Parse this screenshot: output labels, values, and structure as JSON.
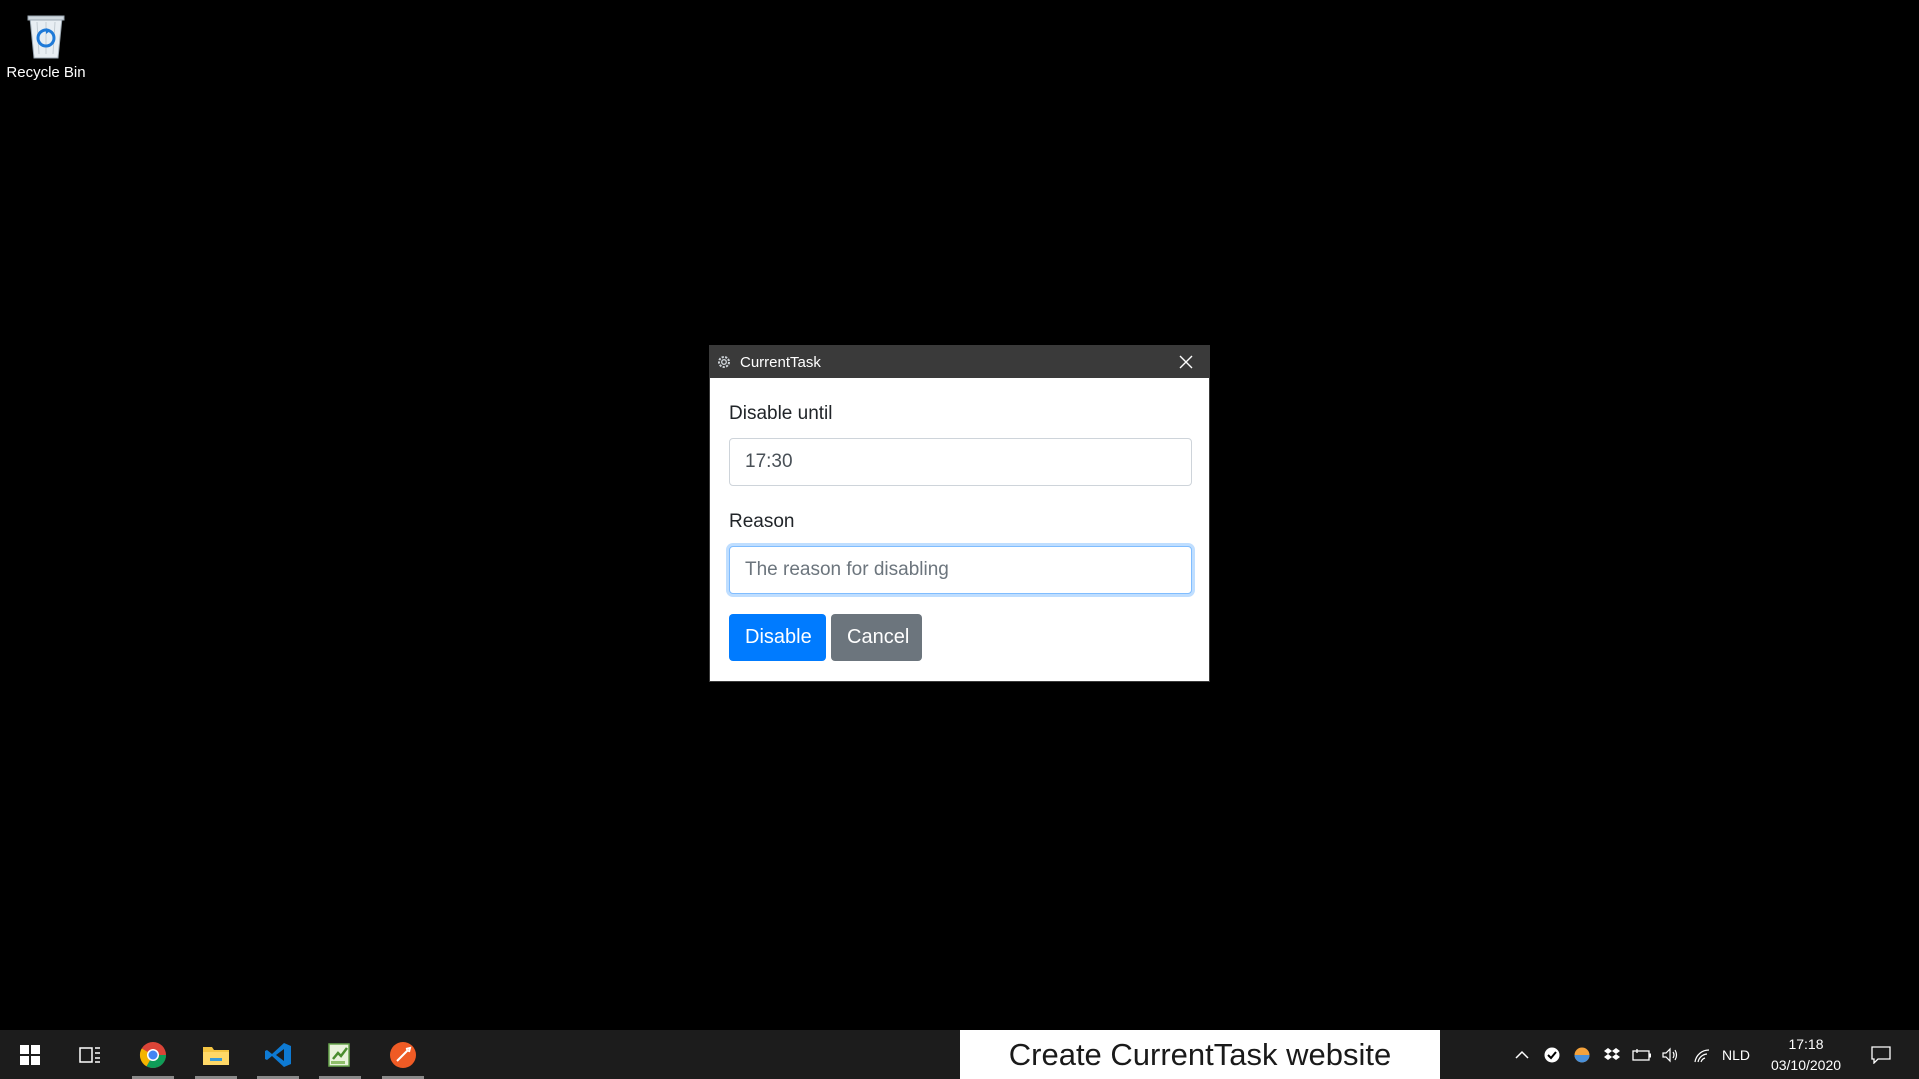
{
  "desktop": {
    "recycle_bin_label": "Recycle Bin"
  },
  "dialog": {
    "title": "CurrentTask",
    "fields": {
      "disable_until_label": "Disable until",
      "disable_until_value": "17:30",
      "reason_label": "Reason",
      "reason_placeholder": "The reason for disabling"
    },
    "buttons": {
      "disable_label": "Disable",
      "cancel_label": "Cancel"
    }
  },
  "taskbar": {
    "apps": [
      "windows-start",
      "task-view",
      "chrome",
      "file-explorer",
      "vscode",
      "notepad-plus-plus",
      "postman"
    ],
    "current_task": "Create CurrentTask website",
    "tray": {
      "language": "NLD",
      "time": "17:18",
      "date": "03/10/2020"
    }
  },
  "colors": {
    "primary": "#007bff",
    "secondary": "#6c757d",
    "titlebar": "#3a3a3a",
    "taskbar": "#1c1c1c"
  }
}
